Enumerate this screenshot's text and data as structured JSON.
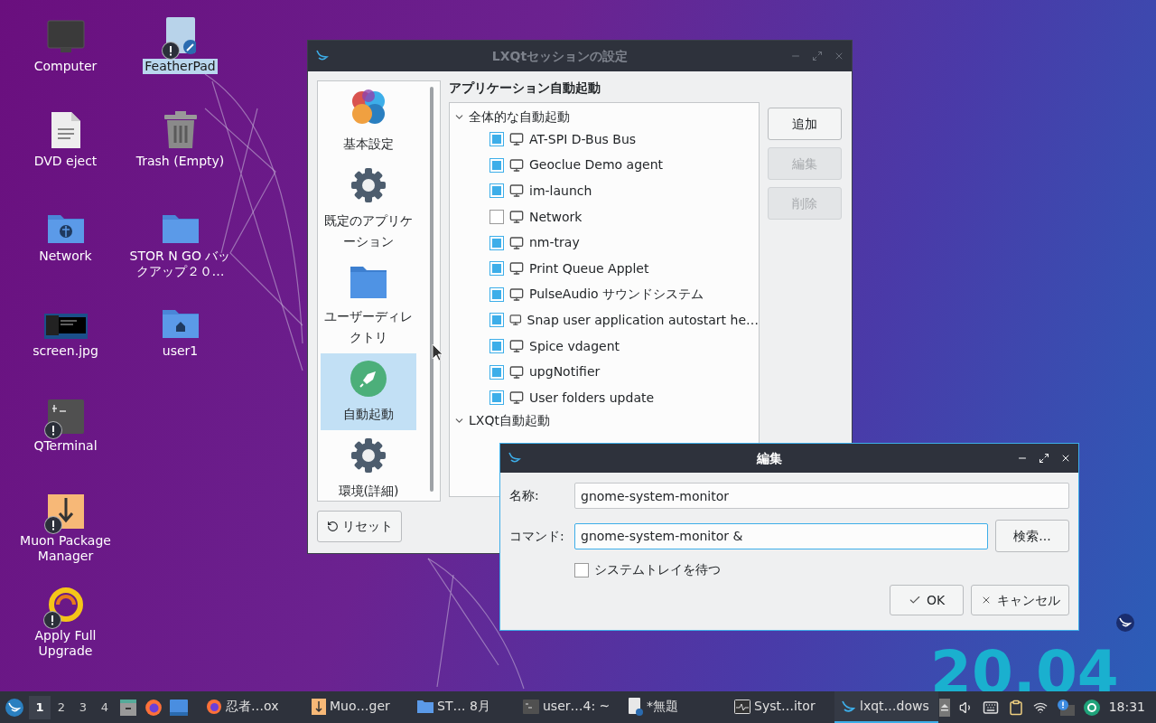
{
  "desktop": {
    "columns": [
      [
        {
          "label": "Computer",
          "kind": "monitor",
          "warning": false,
          "selected": false
        },
        {
          "label": "DVD eject",
          "kind": "document",
          "warning": false,
          "selected": false
        },
        {
          "label": "Network",
          "kind": "network-folder",
          "warning": false,
          "selected": false
        },
        {
          "label": "screen.jpg",
          "kind": "image",
          "warning": false,
          "selected": false
        },
        {
          "label": "QTerminal",
          "kind": "terminal",
          "warning": true,
          "selected": false
        },
        {
          "label": "Muon Package Manager",
          "kind": "package",
          "warning": true,
          "selected": false
        },
        {
          "label": "Apply Full Upgrade",
          "kind": "upgrade",
          "warning": true,
          "selected": false
        }
      ],
      [
        {
          "label": "FeatherPad",
          "kind": "editor",
          "warning": true,
          "selected": true
        },
        {
          "label": "Trash (Empty)",
          "kind": "trash",
          "warning": false,
          "selected": false
        },
        {
          "label": "STOR N GO バックアップ２０…",
          "kind": "folder",
          "warning": false,
          "selected": false
        },
        {
          "label": "user1",
          "kind": "home-folder",
          "warning": false,
          "selected": false
        }
      ]
    ],
    "wallpaper_text": [
      "20.04"
    ]
  },
  "session_window": {
    "title": "LXQtセッションの設定",
    "active": false,
    "sidebar": [
      {
        "label": "基本設定",
        "kind": "appearance",
        "selected": false
      },
      {
        "label": "既定のアプリケーション",
        "kind": "gear",
        "selected": false
      },
      {
        "label": "ユーザーディレクトリ",
        "kind": "folder",
        "selected": false
      },
      {
        "label": "自動起動",
        "kind": "rocket",
        "selected": true
      },
      {
        "label": "環境(詳細)",
        "kind": "gear",
        "selected": false
      }
    ],
    "heading": "アプリケーション自動起動",
    "tree": [
      {
        "label": "全体的な自動起動",
        "expanded": true,
        "children": [
          {
            "label": "AT-SPI D-Bus Bus",
            "checked": true
          },
          {
            "label": "Geoclue Demo agent",
            "checked": true
          },
          {
            "label": "im-launch",
            "checked": true
          },
          {
            "label": "Network",
            "checked": false
          },
          {
            "label": "nm-tray",
            "checked": true
          },
          {
            "label": "Print Queue Applet",
            "checked": true
          },
          {
            "label": "PulseAudio サウンドシステム",
            "checked": true
          },
          {
            "label": "Snap user application autostart he…",
            "checked": true
          },
          {
            "label": "Spice vdagent",
            "checked": true
          },
          {
            "label": "upgNotifier",
            "checked": true
          },
          {
            "label": "User folders update",
            "checked": true
          }
        ]
      },
      {
        "label": "LXQt自動起動",
        "expanded": true
      }
    ],
    "buttons": [
      {
        "label": "追加",
        "disabled": false
      },
      {
        "label": "編集",
        "disabled": true
      },
      {
        "label": "削除",
        "disabled": true
      }
    ],
    "reset_button": "リセット"
  },
  "edit_dialog": {
    "title": "編集",
    "active": true,
    "name_label": "名称:",
    "name_value": "gnome-system-monitor",
    "command_label": "コマンド:",
    "command_value": "gnome-system-monitor &",
    "search_button": "検索...",
    "wait_tray": {
      "label": "システムトレイを待つ",
      "checked": false
    },
    "ok_button": "OK",
    "cancel_button": "キャンセル"
  },
  "taskbar": {
    "desktops": [
      {
        "label": "1",
        "selected": true
      },
      {
        "label": "2",
        "selected": false
      },
      {
        "label": "3",
        "selected": false
      },
      {
        "label": "4",
        "selected": false
      }
    ],
    "tasks": [
      {
        "label": "忍者…ox",
        "kind": "firefox",
        "selected": false
      },
      {
        "label": "Muo…ger",
        "kind": "package",
        "selected": false
      },
      {
        "label": "ST… 8月",
        "kind": "folder",
        "selected": false
      },
      {
        "label": "user…4: ~",
        "kind": "terminal",
        "selected": false
      },
      {
        "label": "*無題",
        "kind": "editor",
        "selected": false
      },
      {
        "label": "Syst…itor",
        "kind": "monitor",
        "selected": false
      },
      {
        "label": "lxqt…dows",
        "kind": "lxqt",
        "selected": true
      }
    ],
    "clock": "18:31"
  }
}
